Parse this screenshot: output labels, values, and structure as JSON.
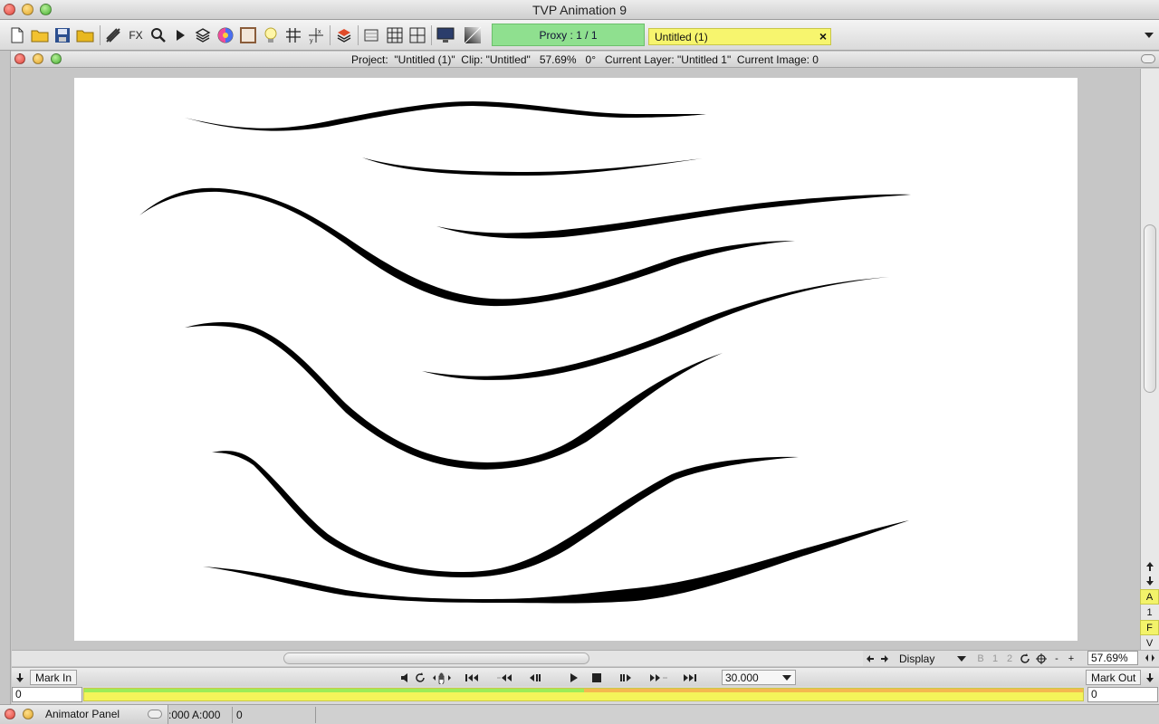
{
  "app": {
    "title": "TVP Animation 9"
  },
  "toolbar": {
    "proxy_label": "Proxy : 1 / 1",
    "doc_tab_label": "Untitled (1)",
    "fx_label": "FX"
  },
  "statusbar": {
    "text": "Project:  \"Untitled (1)\"  Clip: \"Untitled\"   57.69%   0°   Current Layer: \"Untitled 1\"  Current Image: 0"
  },
  "side_buttons": [
    "A",
    "1",
    "F",
    "V"
  ],
  "display_controls": {
    "display_label": "Display",
    "b_label": "B",
    "one_label": "1",
    "two_label": "2",
    "minus": "-",
    "plus": "+",
    "zoom": "57.69%"
  },
  "transport": {
    "mark_in": "Mark In",
    "mark_out": "Mark Out",
    "fps": "30.000"
  },
  "timeline": {
    "start_frame": "0",
    "end_frame": "0"
  },
  "bottom": {
    "animator_panel": "Animator Panel",
    "info": ":000 A:000",
    "value": "0"
  }
}
